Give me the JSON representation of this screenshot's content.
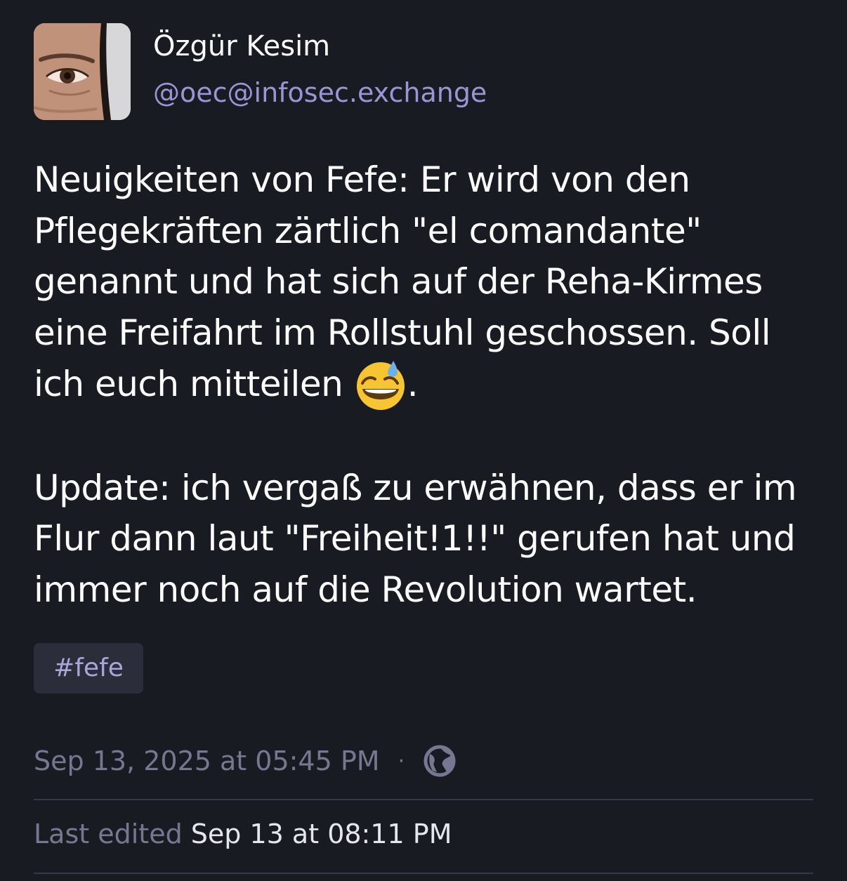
{
  "author": {
    "display_name": "Özgür Kesim",
    "handle": "@oec@infosec.exchange",
    "avatar": "avatar-photo"
  },
  "post": {
    "paragraph1_text": "Neuigkeiten von Fefe: Er wird von den Pflegekräften zärtlich \"el comandante\" genannt und hat sich auf der Reha-Kirmes eine Freifahrt im Rollstuhl geschossen. Soll ich euch mitteilen",
    "paragraph1_emoji": "grinning-face-with-sweat-emoji",
    "paragraph1_end": ".",
    "paragraph2_text": "Update: ich vergaß zu erwähnen, dass er im Flur dann laut \"Freiheit!1!!\" gerufen hat und immer noch auf die Revolution wartet.",
    "hashtag": "#fefe"
  },
  "meta": {
    "timestamp": "Sep 13, 2025 at 05:45 PM",
    "separator": "·",
    "visibility_icon": "globe-icon",
    "edited_label": "Last edited",
    "edited_value": "Sep 13 at 08:11 PM"
  },
  "colors": {
    "background": "#191b22",
    "handle": "#9a96d6",
    "muted": "#767891",
    "hashtag_bg": "#2c2d3a",
    "divider": "#34364a"
  }
}
